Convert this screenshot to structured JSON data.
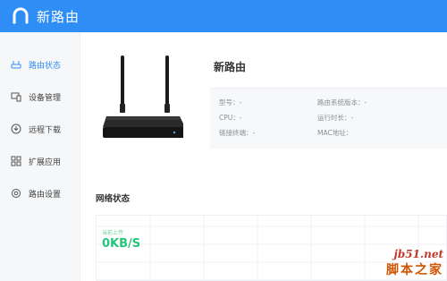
{
  "app": {
    "title": "新路由",
    "brand_color": "#2f8ef5"
  },
  "sidebar": {
    "items": [
      {
        "label": "路由状态",
        "icon": "router-icon",
        "active": true
      },
      {
        "label": "设备管理",
        "icon": "devices-icon",
        "active": false
      },
      {
        "label": "远程下载",
        "icon": "download-icon",
        "active": false
      },
      {
        "label": "扩展应用",
        "icon": "apps-icon",
        "active": false
      },
      {
        "label": "路由设置",
        "icon": "settings-icon",
        "active": false
      }
    ]
  },
  "router": {
    "name": "新路由",
    "model": "型号：-",
    "firmware": "路由系统版本：-",
    "cpu": "CPU：-",
    "uptime": "运行时长：-",
    "connected_clients": "链接终端：-",
    "mac": "MAC地址："
  },
  "network": {
    "section_title": "网络状态",
    "upload_label": "当前上传",
    "upload_value": "0KB/S"
  },
  "watermark": {
    "url": "jb51.net",
    "site": "脚本之家"
  }
}
